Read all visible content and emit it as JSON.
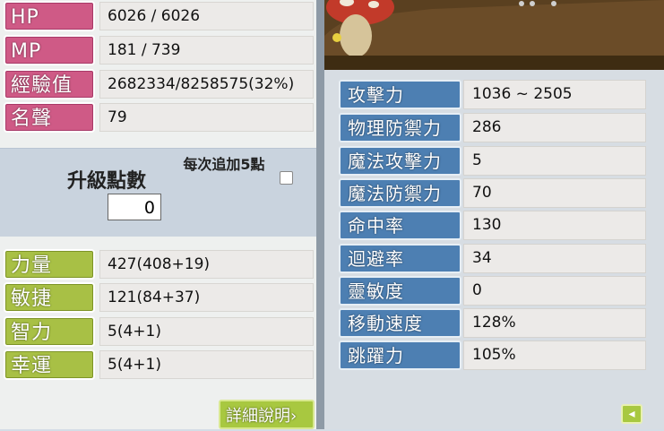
{
  "basic_stats": [
    {
      "label": "HP",
      "value": "6026 / 6026"
    },
    {
      "label": "MP",
      "value": "181 / 739"
    },
    {
      "label": "經驗值",
      "value": "2682334/8258575(32%)"
    },
    {
      "label": "名聲",
      "value": "79"
    }
  ],
  "ap": {
    "title": "升級點數",
    "extra_label": "每次追加5點",
    "value": "0"
  },
  "attributes": [
    {
      "label": "力量",
      "value": "427(408+19)"
    },
    {
      "label": "敏捷",
      "value": "121(84+37)"
    },
    {
      "label": "智力",
      "value": "5(4+1)"
    },
    {
      "label": "幸運",
      "value": "5(4+1)"
    }
  ],
  "detail_button": "詳細說明›",
  "detail_stats": [
    {
      "label": "攻擊力",
      "value": "1036 ~ 2505"
    },
    {
      "label": "物理防禦力",
      "value": "286"
    },
    {
      "label": "魔法攻擊力",
      "value": "5"
    },
    {
      "label": "魔法防禦力",
      "value": "70"
    },
    {
      "label": "命中率",
      "value": "130"
    },
    {
      "label": "迴避率",
      "value": "34"
    },
    {
      "label": "靈敏度",
      "value": "0"
    },
    {
      "label": "移動速度",
      "value": "128%"
    },
    {
      "label": "跳躍力",
      "value": "105%"
    }
  ],
  "back_icon": "back-arrow-icon",
  "colors": {
    "pink": "#cf5a86",
    "green": "#a8c045",
    "blue": "#4d7fb2"
  }
}
